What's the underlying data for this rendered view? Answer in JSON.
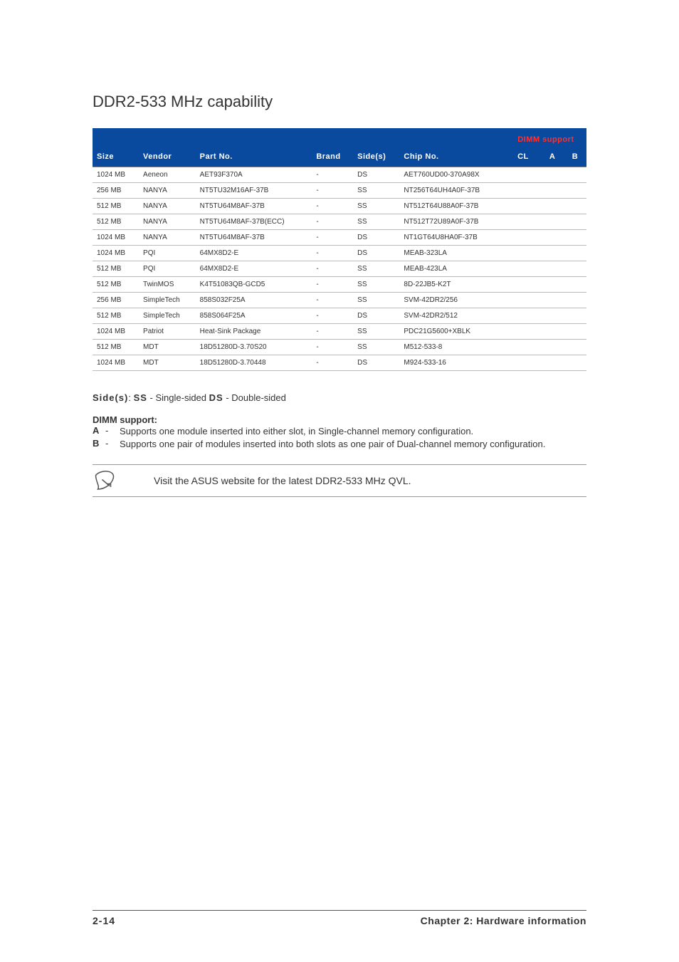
{
  "title": "DDR2-533 MHz capability",
  "table": {
    "headers": {
      "size": "Size",
      "vendor": "Vendor",
      "partno": "Part No.",
      "brand": "Brand",
      "sides": "Side(s)",
      "chipno": "Chip No.",
      "dimm_support_label": "DIMM support",
      "cl": "CL",
      "a": "A",
      "b": "B"
    },
    "rows": [
      {
        "size": "1024 MB",
        "vendor": "Aeneon",
        "partno": "AET93F370A",
        "brand": "-",
        "sides": "DS",
        "chipno": "AET760UD00-370A98X",
        "cl": "",
        "a": "",
        "b": ""
      },
      {
        "size": "256 MB",
        "vendor": "NANYA",
        "partno": "NT5TU32M16AF-37B",
        "brand": "-",
        "sides": "SS",
        "chipno": "NT256T64UH4A0F-37B",
        "cl": "",
        "a": "",
        "b": ""
      },
      {
        "size": "512 MB",
        "vendor": "NANYA",
        "partno": "NT5TU64M8AF-37B",
        "brand": "-",
        "sides": "SS",
        "chipno": "NT512T64U88A0F-37B",
        "cl": "",
        "a": "",
        "b": ""
      },
      {
        "size": "512 MB",
        "vendor": "NANYA",
        "partno": "NT5TU64M8AF-37B(ECC)",
        "brand": "-",
        "sides": "SS",
        "chipno": "NT512T72U89A0F-37B",
        "cl": "",
        "a": "",
        "b": ""
      },
      {
        "size": "1024 MB",
        "vendor": "NANYA",
        "partno": "NT5TU64M8AF-37B",
        "brand": "-",
        "sides": "DS",
        "chipno": "NT1GT64U8HA0F-37B",
        "cl": "",
        "a": "",
        "b": ""
      },
      {
        "size": "1024 MB",
        "vendor": "PQI",
        "partno": "64MX8D2-E",
        "brand": "-",
        "sides": "DS",
        "chipno": "MEAB-323LA",
        "cl": "",
        "a": "",
        "b": ""
      },
      {
        "size": "512 MB",
        "vendor": "PQI",
        "partno": "64MX8D2-E",
        "brand": "-",
        "sides": "SS",
        "chipno": "MEAB-423LA",
        "cl": "",
        "a": "",
        "b": ""
      },
      {
        "size": "512 MB",
        "vendor": "TwinMOS",
        "partno": "K4T51083QB-GCD5",
        "brand": "-",
        "sides": "SS",
        "chipno": "8D-22JB5-K2T",
        "cl": "",
        "a": "",
        "b": ""
      },
      {
        "size": "256 MB",
        "vendor": "SimpleTech",
        "partno": "858S032F25A",
        "brand": "-",
        "sides": "SS",
        "chipno": "SVM-42DR2/256",
        "cl": "",
        "a": "",
        "b": ""
      },
      {
        "size": "512 MB",
        "vendor": "SimpleTech",
        "partno": "858S064F25A",
        "brand": "-",
        "sides": "DS",
        "chipno": "SVM-42DR2/512",
        "cl": "",
        "a": "",
        "b": ""
      },
      {
        "size": "1024 MB",
        "vendor": "Patriot",
        "partno": "Heat-Sink Package",
        "brand": "-",
        "sides": "SS",
        "chipno": "PDC21G5600+XBLK",
        "cl": "",
        "a": "",
        "b": ""
      },
      {
        "size": "512 MB",
        "vendor": "MDT",
        "partno": "18D51280D-3.70S20",
        "brand": "-",
        "sides": "SS",
        "chipno": "M512-533-8",
        "cl": "",
        "a": "",
        "b": ""
      },
      {
        "size": "1024 MB",
        "vendor": "MDT",
        "partno": "18D51280D-3.70448",
        "brand": "-",
        "sides": "DS",
        "chipno": "M924-533-16",
        "cl": "",
        "a": "",
        "b": ""
      }
    ]
  },
  "sides_legend": {
    "label": "Side(s)",
    "ss_key": "SS",
    "ss_val": " - Single-sided   ",
    "ds_key": "DS",
    "ds_val": " - Double-sided"
  },
  "dimm_support": {
    "header": "DIMM support:",
    "a_key": "A",
    "a_text": "Supports one module inserted into either slot, in Single-channel memory configuration.",
    "b_key": "B",
    "b_text": "Supports one pair of modules inserted into both slots as one pair of Dual-channel memory configuration."
  },
  "note": "Visit the ASUS website for the latest DDR2-533 MHz QVL.",
  "footer": {
    "page": "2-14",
    "chapter": "Chapter 2: Hardware information"
  }
}
